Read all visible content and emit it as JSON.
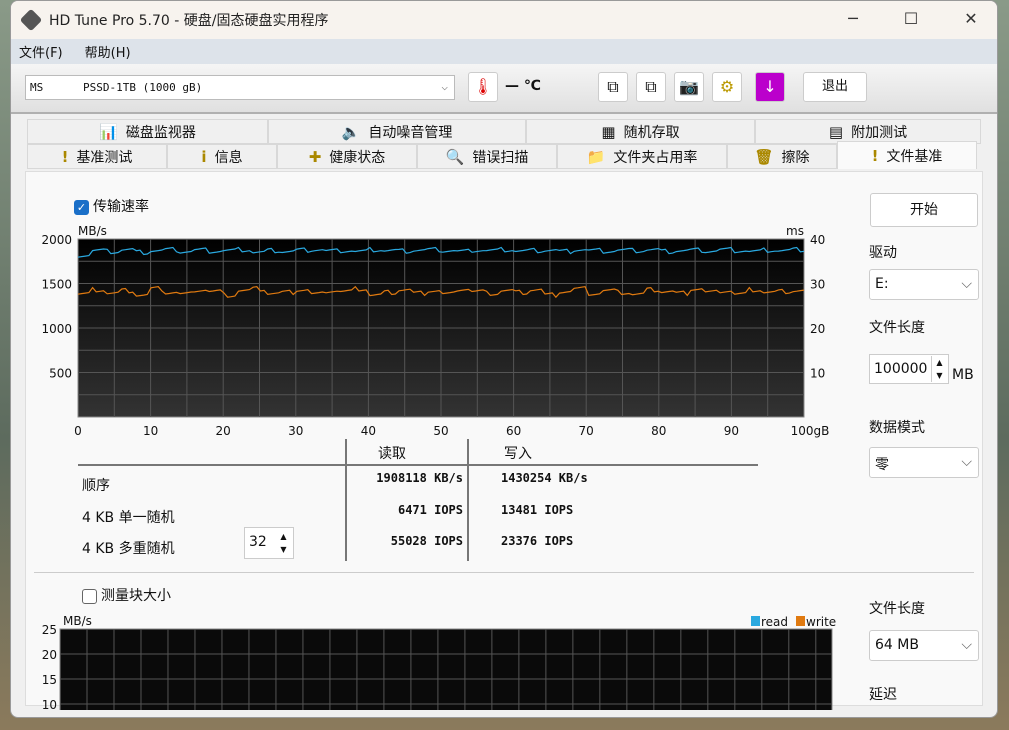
{
  "window": {
    "title": "HD Tune Pro 5.70 - 硬盘/固态硬盘实用程序",
    "minimize": "─",
    "maximize": "☐",
    "close": "✕"
  },
  "menu": [
    "文件(F)",
    "帮助(H)"
  ],
  "toolbar": {
    "drive": "MS      PSSD-1TB (1000 gB)",
    "temperature": "— ℃",
    "exit": "退出",
    "icons": [
      "copy-icon",
      "copy-all-icon",
      "camera-icon",
      "settings-icon",
      "download-icon"
    ]
  },
  "tabs_top": [
    {
      "label": "磁盘监视器",
      "icon": "📊"
    },
    {
      "label": "自动噪音管理",
      "icon": "🔈"
    },
    {
      "label": "随机存取",
      "icon": "▦"
    },
    {
      "label": "附加测试",
      "icon": "▤"
    }
  ],
  "tabs_bottom": [
    {
      "label": "基准测试",
      "icon": "!"
    },
    {
      "label": "信息",
      "icon": "i"
    },
    {
      "label": "健康状态",
      "icon": "✚"
    },
    {
      "label": "错误扫描",
      "icon": "🔍"
    },
    {
      "label": "文件夹占用率",
      "icon": "📁"
    },
    {
      "label": "擦除",
      "icon": "🗑"
    },
    {
      "label": "文件基准",
      "icon": "!"
    }
  ],
  "active_tab": "文件基准",
  "transfer": {
    "checkbox": "传输速率",
    "checked": true
  },
  "chart_data": {
    "type": "line",
    "ylabel_left": "MB/s",
    "ylabel_right": "ms",
    "xlabel": "gB",
    "ylim_left": [
      0,
      2000
    ],
    "ylim_right": [
      0,
      40
    ],
    "xlim": [
      0,
      100
    ],
    "yticks_left": [
      "500",
      "1000",
      "1500",
      "2000"
    ],
    "yticks_right": [
      "10",
      "20",
      "30",
      "40"
    ],
    "xticks": [
      "0",
      "10",
      "20",
      "30",
      "40",
      "50",
      "60",
      "70",
      "80",
      "90",
      "100gB"
    ],
    "grid": true,
    "colors": {
      "read": "#2aa9e0",
      "write": "#e07a10"
    },
    "series": [
      {
        "key": "read",
        "values": [
          1820,
          1870,
          1860,
          1880,
          1850,
          1870,
          1880,
          1860,
          1875,
          1865,
          1870,
          1880,
          1850,
          1870,
          1860,
          1875,
          1880,
          1865,
          1870,
          1860,
          1880,
          1870,
          1865,
          1875,
          1880,
          1870,
          1860,
          1875,
          1870,
          1880,
          1865,
          1870,
          1875,
          1860,
          1880,
          1870,
          1865,
          1875,
          1870,
          1880,
          1860,
          1870,
          1875,
          1865,
          1880,
          1870,
          1860,
          1875,
          1870,
          1880
        ]
      },
      {
        "key": "write",
        "values": [
          1380,
          1430,
          1390,
          1420,
          1370,
          1440,
          1400,
          1380,
          1430,
          1410,
          1370,
          1420,
          1440,
          1390,
          1400,
          1430,
          1380,
          1420,
          1410,
          1440,
          1370,
          1400,
          1430,
          1390,
          1420,
          1380,
          1440,
          1410,
          1390,
          1420,
          1400,
          1430,
          1370,
          1410,
          1440,
          1390,
          1420,
          1400,
          1380,
          1430,
          1410,
          1390,
          1440,
          1400,
          1420,
          1380,
          1430,
          1400,
          1410,
          1420
        ]
      }
    ]
  },
  "results": {
    "headers": [
      "读取",
      "写入"
    ],
    "rows": [
      {
        "label": "顺序",
        "read": "1908118 KB/s",
        "write": "1430254 KB/s"
      },
      {
        "label": "4 KB 单一随机",
        "read": "6471 IOPS",
        "write": "13481 IOPS"
      },
      {
        "label": "4 KB 多重随机",
        "read": "55028 IOPS",
        "write": "23376 IOPS"
      }
    ],
    "queue_depth": "32"
  },
  "side": {
    "start": "开始",
    "drive_label": "驱动",
    "drive": "E:",
    "file_length_label": "文件长度",
    "file_length": "100000",
    "unit": "MB",
    "data_mode_label": "数据模式",
    "data_mode": "零"
  },
  "block": {
    "checkbox": "测量块大小",
    "checked": false,
    "ylabel": "MB/s",
    "yticks": [
      "25",
      "20",
      "15",
      "10"
    ],
    "legend": [
      "read",
      "write"
    ],
    "file_length_label": "文件长度",
    "file_length": "64 MB",
    "delay_label": "延迟"
  }
}
